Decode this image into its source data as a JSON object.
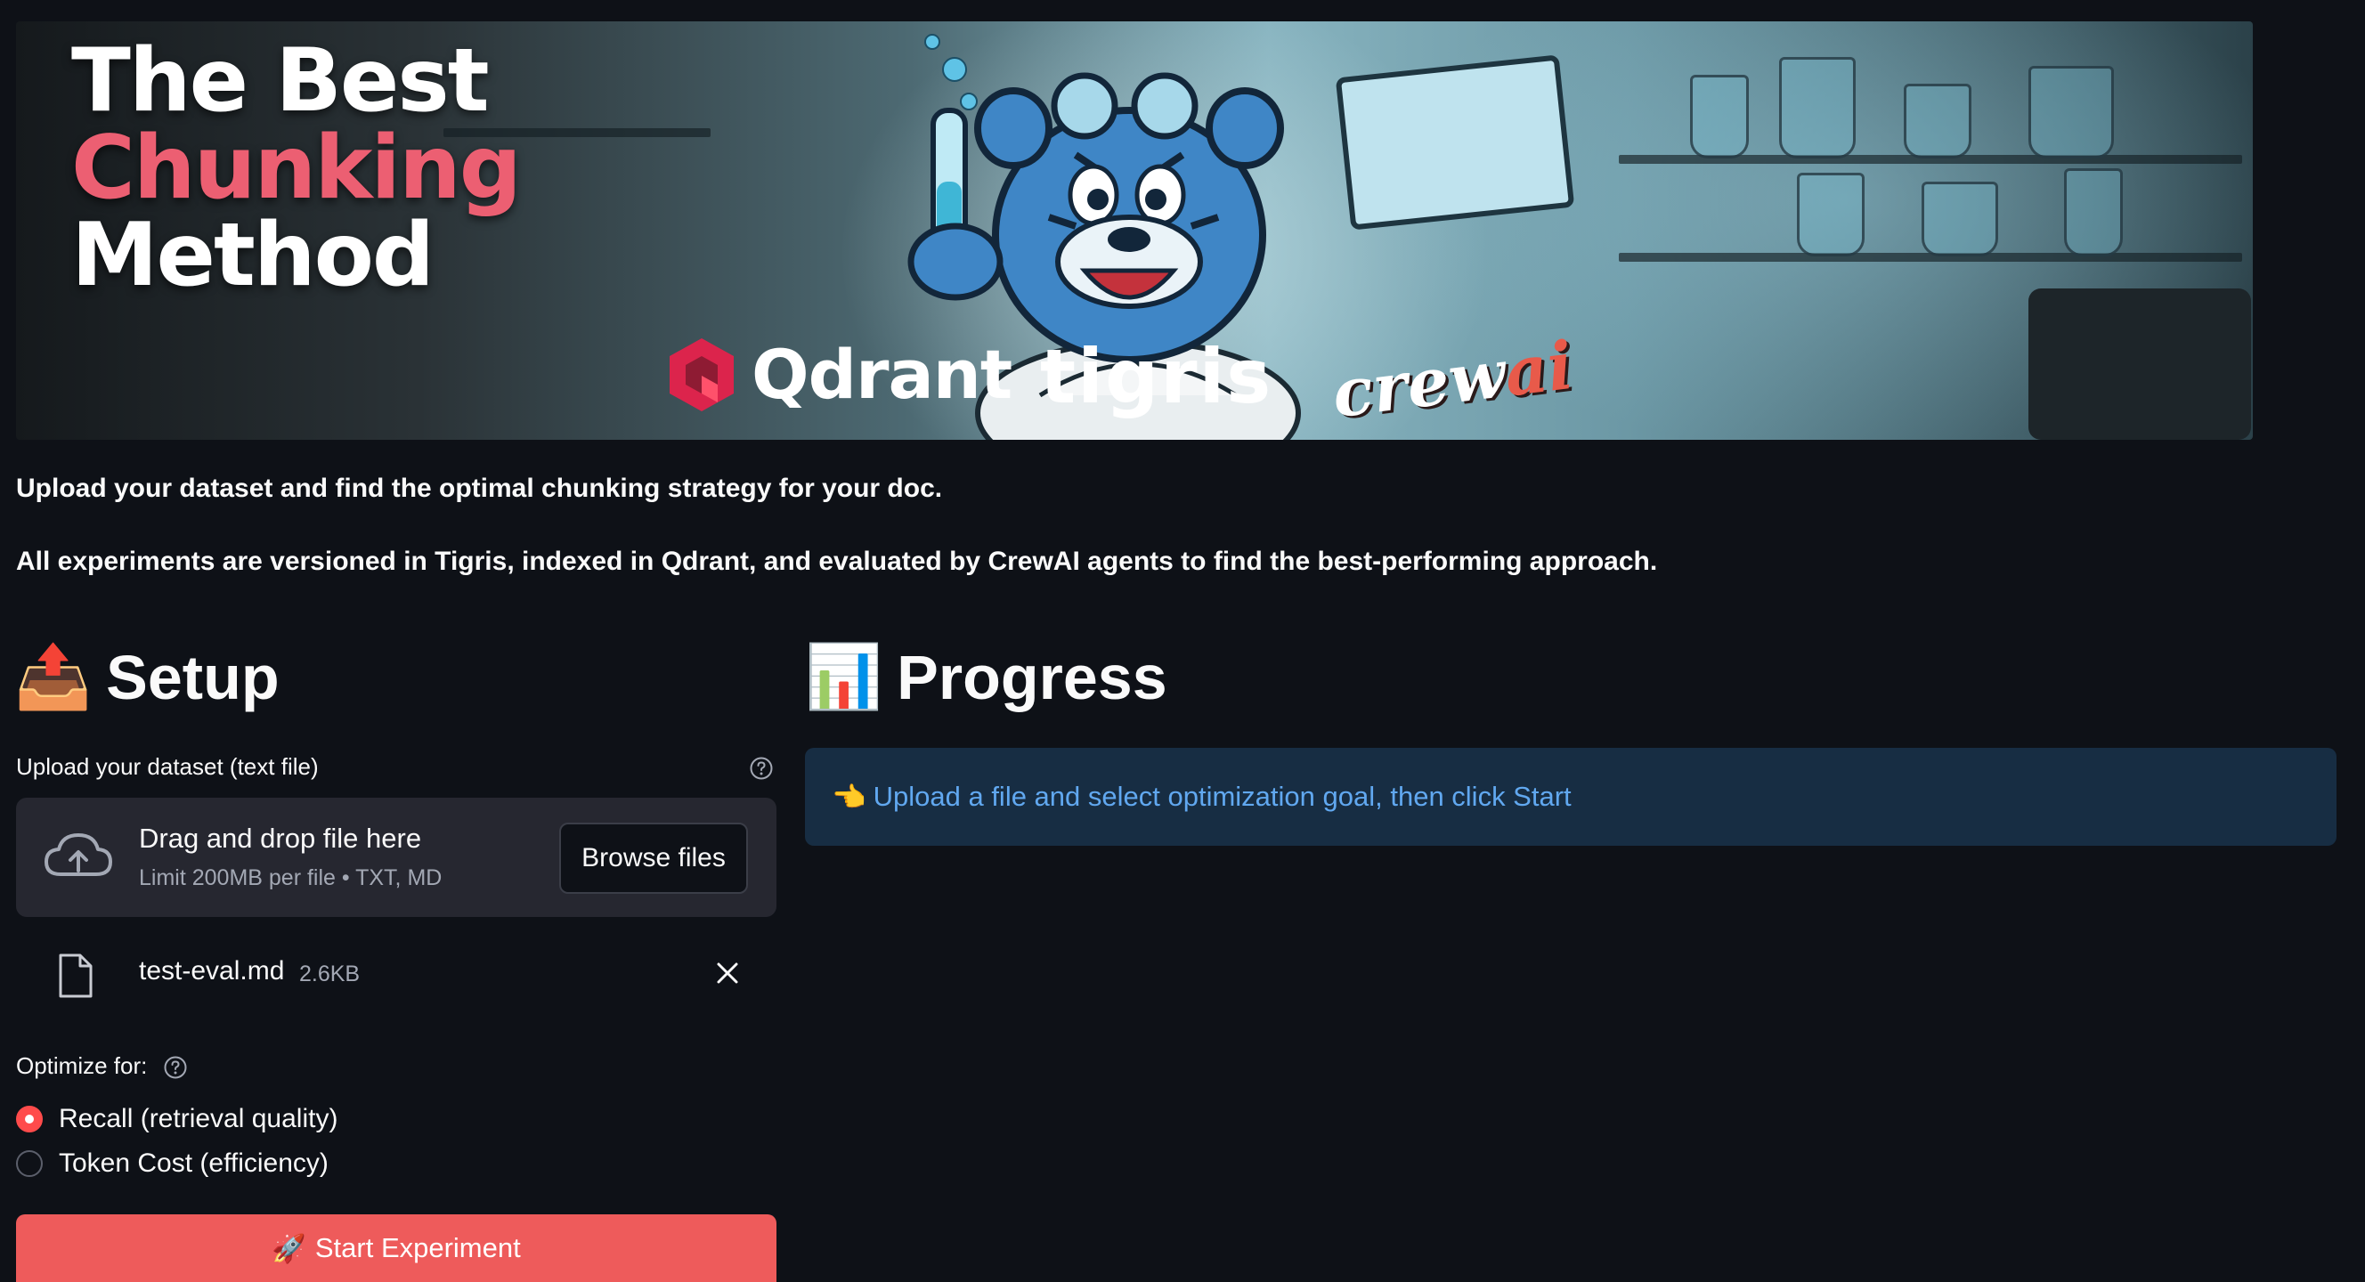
{
  "banner": {
    "title_line1": "The Best",
    "title_line2": "Chunking",
    "title_line3": "Method",
    "logos": {
      "qdrant": "Qdrant",
      "tigris": "tigris",
      "crewai_prefix": "crew",
      "crewai_suffix": "ai"
    }
  },
  "intro": {
    "line1": "Upload your dataset and find the optimal chunking strategy for your doc.",
    "line2": "All experiments are versioned in Tigris, indexed in Qdrant, and evaluated by CrewAI agents to find the best-performing approach."
  },
  "setup": {
    "emoji": "📤",
    "heading": "Setup",
    "upload_label": "Upload your dataset (text file)",
    "dropzone": {
      "main": "Drag and drop file here",
      "sub": "Limit 200MB per file • TXT, MD",
      "browse_label": "Browse files"
    },
    "file": {
      "name": "test-eval.md",
      "size": "2.6KB"
    },
    "optimize_label": "Optimize for:",
    "options": [
      {
        "label": "Recall (retrieval quality)",
        "selected": true
      },
      {
        "label": "Token Cost (efficiency)",
        "selected": false
      }
    ],
    "start_emoji": "🚀",
    "start_label": "Start Experiment"
  },
  "progress": {
    "emoji": "📊",
    "heading": "Progress",
    "info_emoji": "👈",
    "info_text": "Upload a file and select optimization goal, then click Start"
  },
  "colors": {
    "background": "#0e1117",
    "primary": "#ff4b4b",
    "info_bg": "#172d43",
    "info_text": "#61a8f0",
    "dropzone_bg": "#262730"
  },
  "icons": {
    "help": "question-circle-icon",
    "upload": "cloud-upload-icon",
    "file": "file-icon",
    "close": "close-icon"
  }
}
